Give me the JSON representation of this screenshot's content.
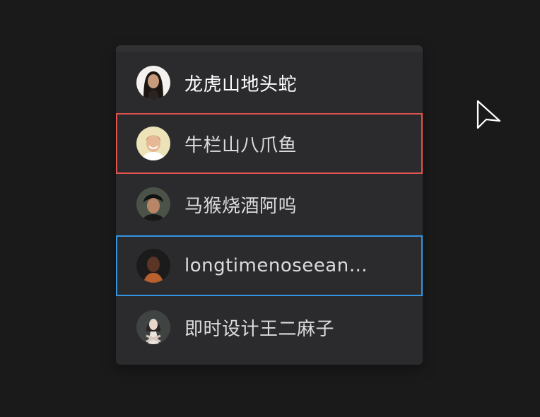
{
  "users": [
    {
      "name": "龙虎山地头蛇",
      "avatar": "avatar-woman-dark-hair"
    },
    {
      "name": "牛栏山八爪鱼",
      "avatar": "avatar-smiling-man"
    },
    {
      "name": "马猴烧酒阿呜",
      "avatar": "avatar-man-dark-hair"
    },
    {
      "name": "longtimenoseean…",
      "avatar": "avatar-bald-man"
    },
    {
      "name": "即时设计王二麻子",
      "avatar": "avatar-woman-pose"
    }
  ],
  "colors": {
    "hover_outline": "#e0534e",
    "selected_outline": "#3594e0",
    "panel_bg": "#2b2b2e",
    "page_bg": "#1a1a1b"
  }
}
